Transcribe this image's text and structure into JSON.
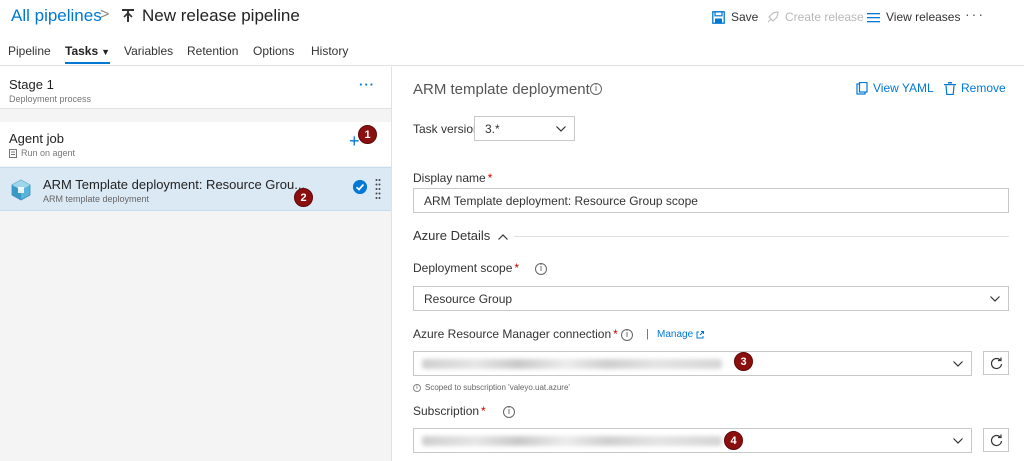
{
  "header": {
    "breadcrumb_root": "All pipelines",
    "breadcrumb_sep": ">",
    "title": "New release pipeline",
    "save_label": "Save",
    "create_release_label": "Create release",
    "view_releases_label": "View releases",
    "more_label": "···"
  },
  "tabs": [
    {
      "label": "Pipeline",
      "active": false
    },
    {
      "label": "Tasks",
      "active": true
    },
    {
      "label": "Variables",
      "active": false
    },
    {
      "label": "Retention",
      "active": false
    },
    {
      "label": "Options",
      "active": false
    },
    {
      "label": "History",
      "active": false
    }
  ],
  "left": {
    "stage_title": "Stage 1",
    "stage_subtitle": "Deployment process",
    "stage_more": "···",
    "agent_title": "Agent job",
    "agent_subtitle": "Run on agent",
    "add_symbol": "+",
    "task_title": "ARM Template deployment: Resource Grou...",
    "task_subtitle": "ARM template deployment"
  },
  "badges": [
    "1",
    "2",
    "3",
    "4"
  ],
  "right": {
    "title": "ARM template deployment",
    "info_glyph": "i",
    "view_yaml_label": "View YAML",
    "remove_label": "Remove",
    "task_version_label": "Task version",
    "task_version_value": "3.*",
    "display_name_label": "Display name",
    "required_mark": "*",
    "display_name_value": "ARM Template deployment: Resource Group scope",
    "section_title": "Azure Details",
    "section_chevron": "^",
    "deployment_scope_label": "Deployment scope",
    "deployment_scope_value": "Resource Group",
    "arm_connection_label": "Azure Resource Manager connection",
    "manage_sep": "|",
    "manage_label": "Manage",
    "scoped_note": "Scoped to subscription 'valeyo.uat.azure'",
    "subscription_label": "Subscription"
  },
  "colors": {
    "accent": "#0078d4",
    "badge": "#8b0f0f",
    "selected_row": "#dbe9f5"
  }
}
